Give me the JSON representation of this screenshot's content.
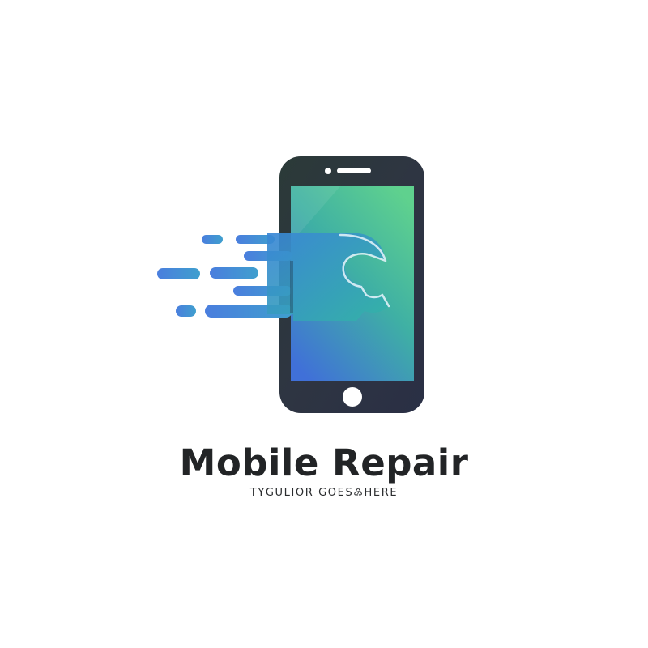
{
  "logo": {
    "name": "Mobile Repair",
    "tagline": "TYGULIOR GOES♹HERE",
    "icon": "phone-wrench-icon",
    "colors": {
      "phone_body": "#2c3440",
      "screen_top": "#5ccf91",
      "screen_bottom": "#3f6fd6",
      "speed_lines": "#4a86d8",
      "text": "#222426"
    }
  }
}
